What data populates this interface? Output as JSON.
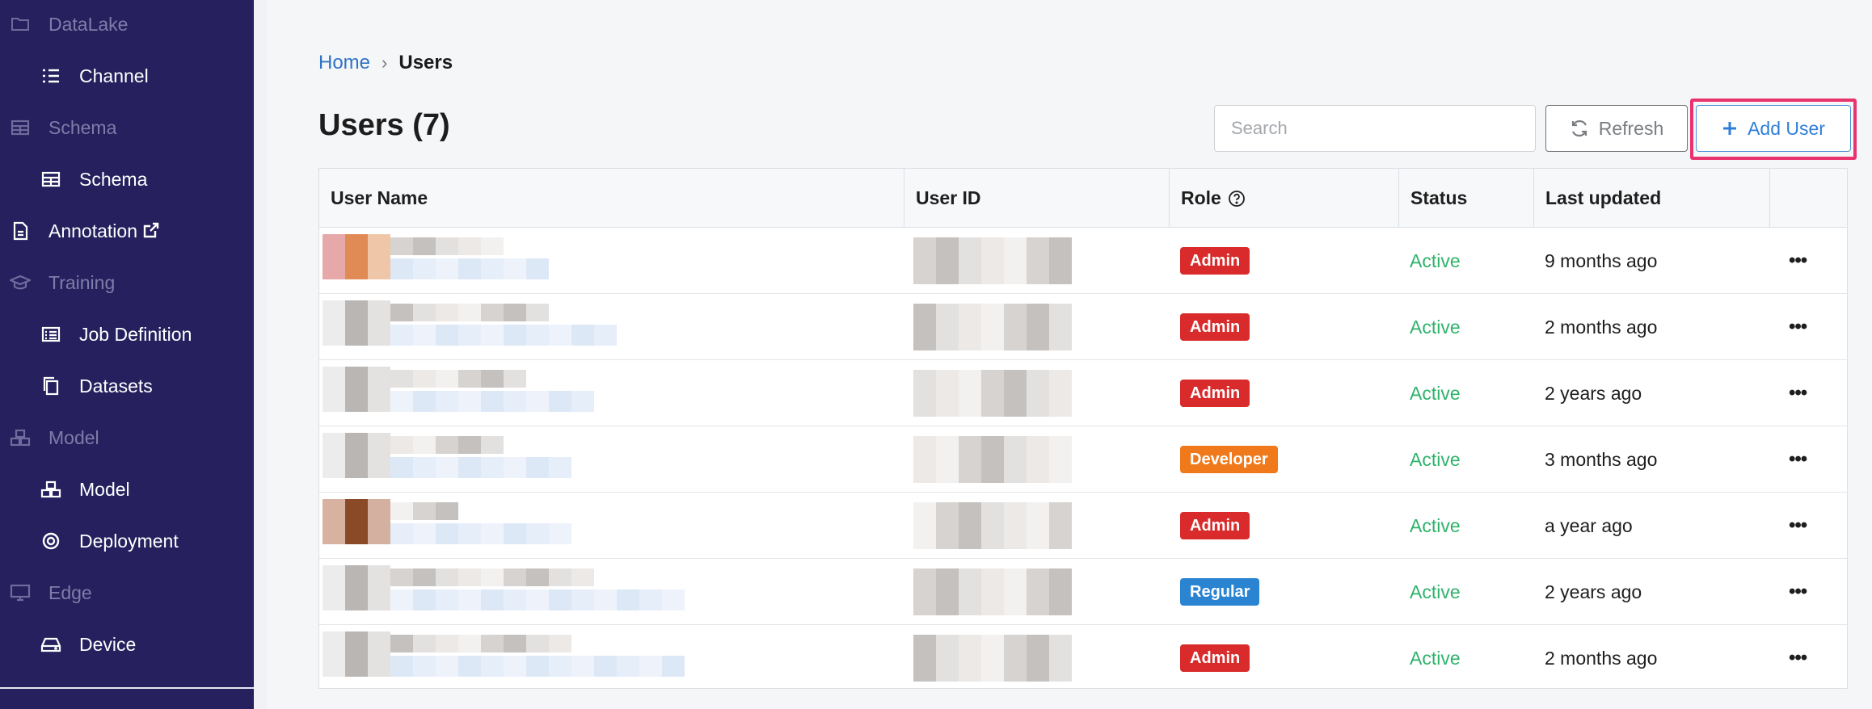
{
  "sidebar": {
    "items": [
      {
        "type": "section",
        "label": "DataLake",
        "icon": "folder-icon"
      },
      {
        "type": "child",
        "label": "Channel",
        "icon": "list-icon"
      },
      {
        "type": "section",
        "label": "Schema",
        "icon": "table-icon"
      },
      {
        "type": "child",
        "label": "Schema",
        "icon": "table-icon"
      },
      {
        "type": "top",
        "label": "Annotation",
        "icon": "file-icon"
      },
      {
        "type": "section",
        "label": "Training",
        "icon": "graduation-cap-icon"
      },
      {
        "type": "child",
        "label": "Job Definition",
        "icon": "list-box-icon"
      },
      {
        "type": "child",
        "label": "Datasets",
        "icon": "copy-icon"
      },
      {
        "type": "section",
        "label": "Model",
        "icon": "cubes-icon"
      },
      {
        "type": "child",
        "label": "Model",
        "icon": "cubes-icon"
      },
      {
        "type": "child",
        "label": "Deployment",
        "icon": "target-icon"
      },
      {
        "type": "section",
        "label": "Edge",
        "icon": "monitor-icon"
      },
      {
        "type": "child",
        "label": "Device",
        "icon": "hdd-icon"
      }
    ]
  },
  "breadcrumb": {
    "home": "Home",
    "separator": "›",
    "current": "Users"
  },
  "page": {
    "title": "Users (7)"
  },
  "toolbar": {
    "search_placeholder": "Search",
    "search_value": "",
    "refresh_label": "Refresh",
    "add_label": "Add User"
  },
  "table": {
    "headers": [
      "User Name",
      "User ID",
      "Role",
      "Status",
      "Last updated"
    ],
    "rows": [
      {
        "role": "Admin",
        "status": "Active",
        "updated": "9 months ago"
      },
      {
        "role": "Admin",
        "status": "Active",
        "updated": "2 months ago"
      },
      {
        "role": "Admin",
        "status": "Active",
        "updated": "2 years ago"
      },
      {
        "role": "Developer",
        "status": "Active",
        "updated": "3 months ago"
      },
      {
        "role": "Admin",
        "status": "Active",
        "updated": "a year ago"
      },
      {
        "role": "Regular",
        "status": "Active",
        "updated": "2 years ago"
      },
      {
        "role": "Admin",
        "status": "Active",
        "updated": "2 months ago"
      }
    ]
  },
  "colors": {
    "sidebar_bg": "#26215e",
    "accent_blue": "#2f7ed8",
    "highlight": "#e8336e",
    "role_admin": "#d92b2b",
    "role_developer": "#f07a1b",
    "role_regular": "#2a84d2",
    "status_active": "#2fb36b"
  }
}
